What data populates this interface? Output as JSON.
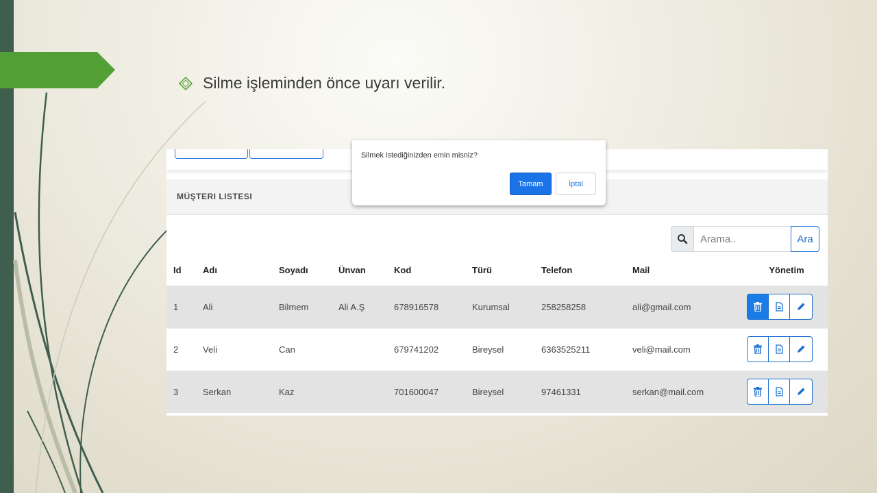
{
  "slide": {
    "bullet_text": "Silme işleminden önce uyarı verilir.",
    "bullet_icon": "diamond-bullet-icon",
    "accent_green": "#52a035",
    "sidebar_color": "#3f5e4e"
  },
  "app": {
    "list_title": "MÜŞTERI LISTESI",
    "search": {
      "placeholder": "Arama..",
      "button_label": "Ara",
      "icon": "search-icon"
    },
    "table": {
      "columns": [
        "Id",
        "Adı",
        "Soyadı",
        "Ünvan",
        "Kod",
        "Türü",
        "Telefon",
        "Mail",
        "Yönetim"
      ],
      "rows": [
        [
          "1",
          "Ali",
          "Bilmem",
          "Ali A.Ş",
          "678916578",
          "Kurumsal",
          "258258258",
          "ali@gmail.com"
        ],
        [
          "2",
          "Veli",
          "Can",
          "",
          "679741202",
          "Bireysel",
          "6363525211",
          "veli@mail.com"
        ],
        [
          "3",
          "Serkan",
          "Kaz",
          "",
          "701600047",
          "Bireysel",
          "97461331",
          "serkan@mail.com"
        ]
      ],
      "actions": [
        "trash-icon",
        "document-icon",
        "pencil-icon"
      ]
    },
    "dialog": {
      "message": "Silmek istediğinizden emin misniz?",
      "ok_label": "Tamam",
      "cancel_label": "İptal"
    },
    "primary_color": "#1b73e8"
  }
}
